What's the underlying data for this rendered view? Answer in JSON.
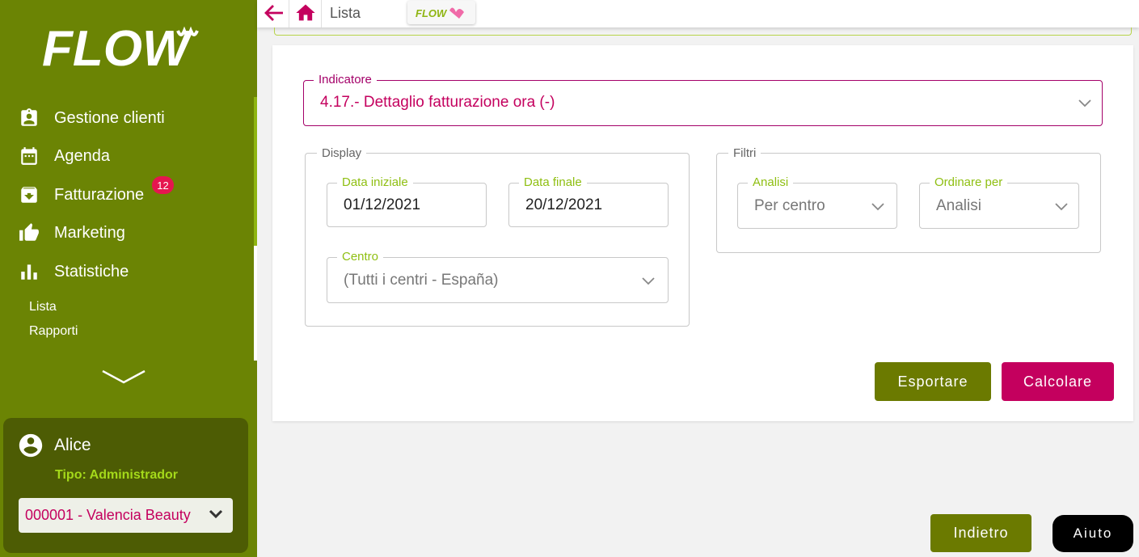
{
  "sidebar": {
    "logo_text": "FLOW",
    "items": [
      {
        "label": "Gestione clienti",
        "icon": "clipboard-user-icon"
      },
      {
        "label": "Agenda",
        "icon": "calendar-icon"
      },
      {
        "label": "Fatturazione",
        "icon": "archive-box-icon",
        "badge": "12"
      },
      {
        "label": "Marketing",
        "icon": "thumbs-up-icon"
      },
      {
        "label": "Statistiche",
        "icon": "bar-chart-icon"
      }
    ],
    "sub_items": [
      "Lista",
      "Rapporti"
    ],
    "user": {
      "name": "Alice",
      "type": "Tipo: Administrador",
      "center": "000001 - Valencia Beauty"
    }
  },
  "topbar": {
    "breadcrumb": "Lista"
  },
  "form": {
    "indicatore": {
      "label": "Indicatore",
      "value": "4.17.- Dettaglio fatturazione ora (-)"
    },
    "display": {
      "legend": "Display",
      "data_iniziale": {
        "label": "Data iniziale",
        "value": "01/12/2021"
      },
      "data_finale": {
        "label": "Data finale",
        "value": "20/12/2021"
      },
      "centro": {
        "label": "Centro",
        "value": "(Tutti i centri - España)"
      }
    },
    "filtri": {
      "legend": "Filtri",
      "analisi": {
        "label": "Analisi",
        "value": "Per centro"
      },
      "ordinare": {
        "label": "Ordinare per",
        "value": "Analisi"
      }
    }
  },
  "buttons": {
    "export": "Esportare",
    "calculate": "Calcolare",
    "back": "Indietro",
    "help": "Aiuto"
  },
  "colors": {
    "sidebar_bg": "#6b8404",
    "accent_magenta": "#c4005e",
    "accent_green": "#8fbf12",
    "button_olive": "#6b7a00"
  }
}
